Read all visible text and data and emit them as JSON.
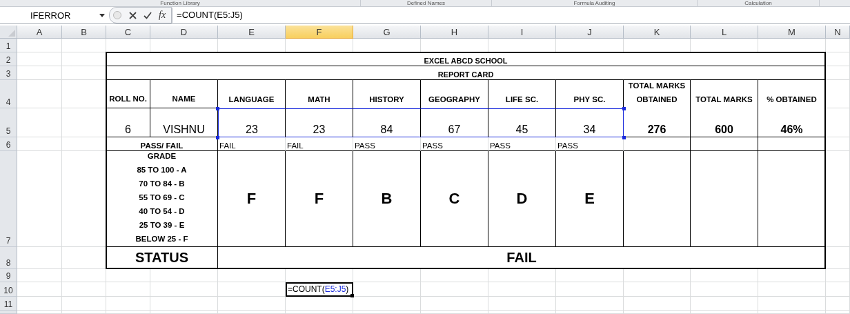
{
  "ribbon_groups": [
    "Function Library",
    "Defined Names",
    "Formula Auditing",
    "Calculation"
  ],
  "formula_bar": {
    "name_box": "IFERROR",
    "function_label": "fx",
    "formula": "=COUNT(E5:J5)"
  },
  "columns": [
    {
      "label": "A",
      "selected": false
    },
    {
      "label": "B",
      "selected": false
    },
    {
      "label": "C",
      "selected": false
    },
    {
      "label": "D",
      "selected": false
    },
    {
      "label": "E",
      "selected": false
    },
    {
      "label": "F",
      "selected": true
    },
    {
      "label": "G",
      "selected": false
    },
    {
      "label": "H",
      "selected": false
    },
    {
      "label": "I",
      "selected": false
    },
    {
      "label": "J",
      "selected": false
    },
    {
      "label": "K",
      "selected": false
    },
    {
      "label": "L",
      "selected": false
    },
    {
      "label": "M",
      "selected": false
    },
    {
      "label": "N",
      "selected": false
    }
  ],
  "rows": [
    "1",
    "2",
    "3",
    "4",
    "5",
    "6",
    "7",
    "8",
    "9",
    "10",
    "11"
  ],
  "report": {
    "title": "EXCEL ABCD SCHOOL",
    "subtitle": "REPORT CARD",
    "headers": [
      "ROLL NO.",
      "NAME",
      "LANGUAGE",
      "MATH",
      "HISTORY",
      "GEOGRAPHY",
      "LIFE SC.",
      "PHY SC.",
      "TOTAL MARKS OBTAINED",
      "TOTAL MARKS",
      "% OBTAINED"
    ],
    "values": [
      {
        "text": "6",
        "bold": false,
        "in_reference": false
      },
      {
        "text": "VISHNU",
        "bold": false,
        "in_reference": false
      },
      {
        "text": "23",
        "bold": false,
        "in_reference": true
      },
      {
        "text": "23",
        "bold": false,
        "in_reference": true
      },
      {
        "text": "84",
        "bold": false,
        "in_reference": true
      },
      {
        "text": "67",
        "bold": false,
        "in_reference": true
      },
      {
        "text": "45",
        "bold": false,
        "in_reference": true
      },
      {
        "text": "34",
        "bold": false,
        "in_reference": true
      },
      {
        "text": "276",
        "bold": true,
        "in_reference": false
      },
      {
        "text": "600",
        "bold": true,
        "in_reference": false
      },
      {
        "text": "46%",
        "bold": true,
        "in_reference": false
      }
    ],
    "pass_fail_label": "PASS/ FAIL",
    "results": [
      "FAIL",
      "FAIL",
      "PASS",
      "PASS",
      "PASS",
      "PASS"
    ],
    "grade_legend": [
      "GRADE",
      "85 TO 100 - A",
      "70 TO 84 - B",
      "55 TO 69 - C",
      "40 TO 54 - D",
      "25 TO 39 - E",
      "BELOW 25 - F"
    ],
    "grades": [
      "F",
      "F",
      "B",
      "C",
      "D",
      "E"
    ],
    "status_label": "STATUS",
    "status": "FAIL"
  },
  "edit_cell": {
    "parts": [
      {
        "text": "=COUNT(",
        "kind": "plain"
      },
      {
        "text": "E5:J5",
        "kind": "reference"
      },
      {
        "text": ")",
        "kind": "plain"
      }
    ]
  }
}
